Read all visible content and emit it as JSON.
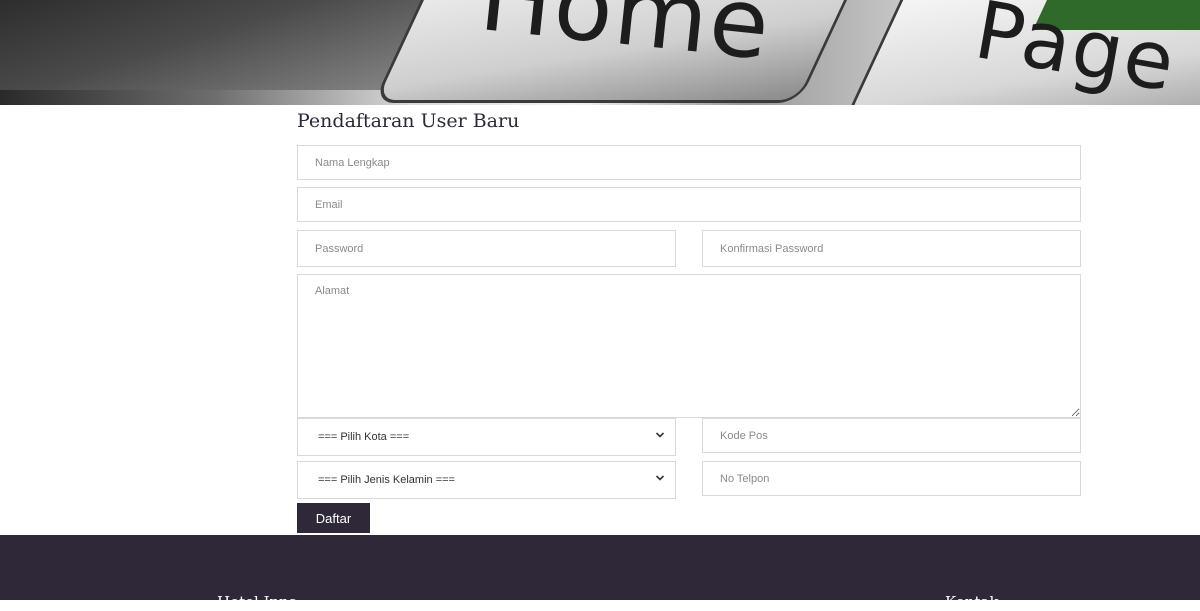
{
  "hero": {
    "key_text_1": "Home",
    "key_text_2": "Page"
  },
  "form": {
    "title": "Pendaftaran User Baru",
    "nama_placeholder": "Nama Lengkap",
    "email_placeholder": "Email",
    "password_placeholder": "Password",
    "konfirmasi_placeholder": "Konfirmasi Password",
    "alamat_placeholder": "Alamat",
    "kota_selected": "=== Pilih Kota ===",
    "kodepos_placeholder": "Kode Pos",
    "jk_selected": "=== Pilih Jenis Kelamin ===",
    "telpon_placeholder": "No Telpon",
    "submit_label": "Daftar"
  },
  "footer": {
    "left_heading": "Hotel Inna",
    "right_heading": "Kontak"
  },
  "colors": {
    "primary": "#2e2838",
    "border": "#d9d9d9"
  }
}
